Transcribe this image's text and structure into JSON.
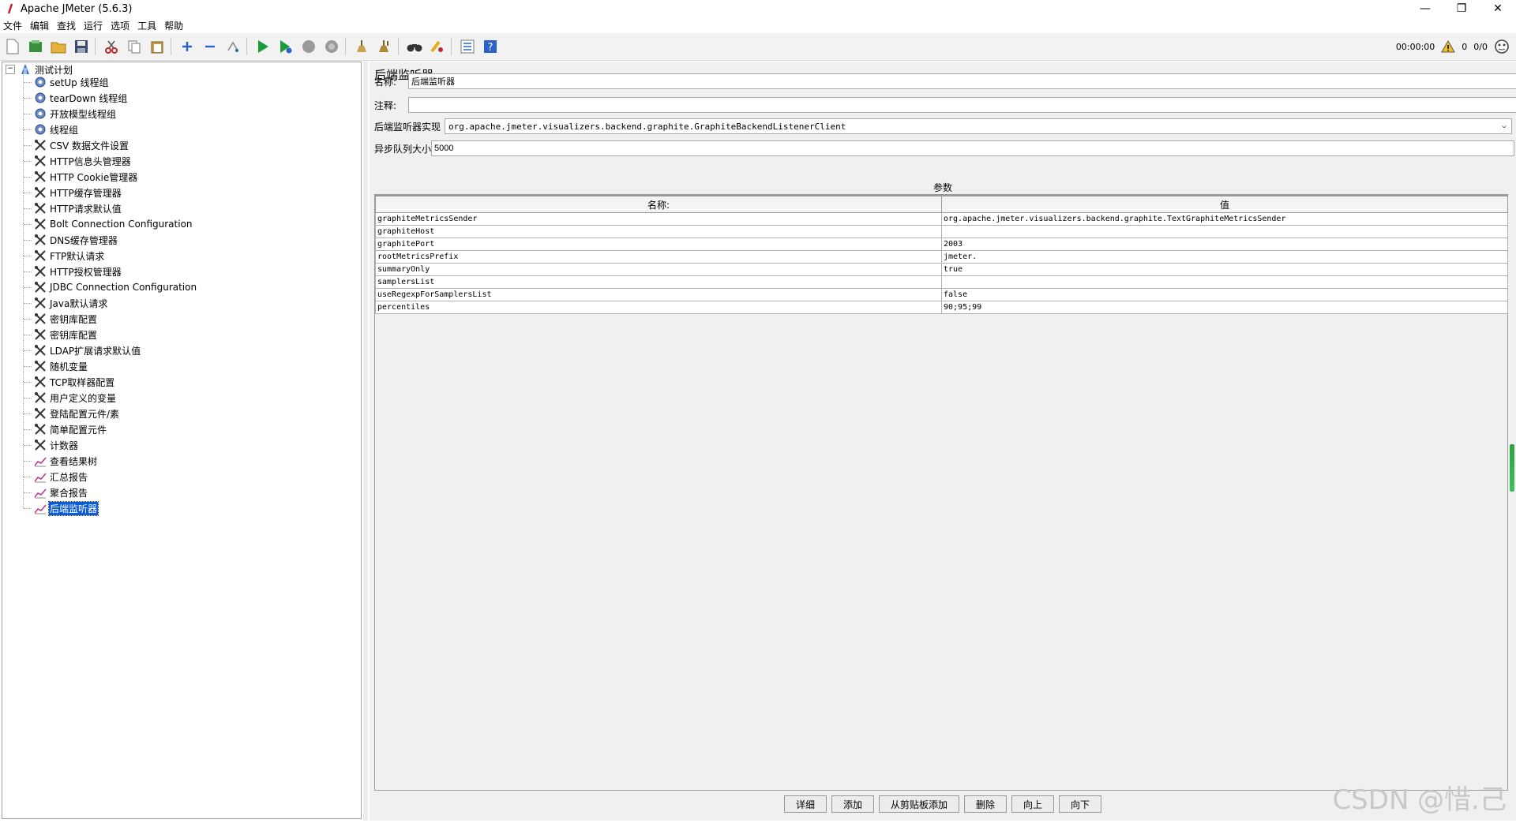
{
  "window": {
    "title": "Apache JMeter (5.6.3)"
  },
  "menu": [
    "文件",
    "编辑",
    "查找",
    "运行",
    "选项",
    "工具",
    "帮助"
  ],
  "status": {
    "timer": "00:00:00",
    "warnings": "0",
    "threads": "0/0"
  },
  "tree": {
    "root": "测试计划",
    "items": [
      {
        "label": "setUp 线程组",
        "icon": "gear-icon"
      },
      {
        "label": "tearDown 线程组",
        "icon": "gear-icon"
      },
      {
        "label": "开放模型线程组",
        "icon": "gear-icon"
      },
      {
        "label": "线程组",
        "icon": "gear-icon"
      },
      {
        "label": "CSV 数据文件设置",
        "icon": "wrench-icon"
      },
      {
        "label": "HTTP信息头管理器",
        "icon": "wrench-icon"
      },
      {
        "label": "HTTP Cookie管理器",
        "icon": "wrench-icon"
      },
      {
        "label": "HTTP缓存管理器",
        "icon": "wrench-icon"
      },
      {
        "label": "HTTP请求默认值",
        "icon": "wrench-icon"
      },
      {
        "label": "Bolt Connection Configuration",
        "icon": "wrench-icon"
      },
      {
        "label": "DNS缓存管理器",
        "icon": "wrench-icon"
      },
      {
        "label": "FTP默认请求",
        "icon": "wrench-icon"
      },
      {
        "label": "HTTP授权管理器",
        "icon": "wrench-icon"
      },
      {
        "label": "JDBC Connection Configuration",
        "icon": "wrench-icon"
      },
      {
        "label": "Java默认请求",
        "icon": "wrench-icon"
      },
      {
        "label": "密钥库配置",
        "icon": "wrench-icon"
      },
      {
        "label": "密钥库配置",
        "icon": "wrench-icon"
      },
      {
        "label": "LDAP扩展请求默认值",
        "icon": "wrench-icon"
      },
      {
        "label": "随机变量",
        "icon": "wrench-icon"
      },
      {
        "label": "TCP取样器配置",
        "icon": "wrench-icon"
      },
      {
        "label": "用户定义的变量",
        "icon": "wrench-icon"
      },
      {
        "label": "登陆配置元件/素",
        "icon": "wrench-icon"
      },
      {
        "label": "简单配置元件",
        "icon": "wrench-icon"
      },
      {
        "label": "计数器",
        "icon": "wrench-icon"
      },
      {
        "label": "查看结果树",
        "icon": "chart-icon"
      },
      {
        "label": "汇总报告",
        "icon": "chart-icon"
      },
      {
        "label": "聚合报告",
        "icon": "chart-icon"
      },
      {
        "label": "后端监听器",
        "icon": "chart-icon",
        "selected": true
      }
    ]
  },
  "panel": {
    "title": "后端监听器",
    "name_label": "名称:",
    "name_value": "后端监听器",
    "comment_label": "注释:",
    "comment_value": "",
    "impl_label": "后端监听器实现",
    "impl_value": "org.apache.jmeter.visualizers.backend.graphite.GraphiteBackendListenerClient",
    "queue_label": "异步队列大小",
    "queue_value": "5000",
    "params_title": "参数",
    "columns": [
      "名称:",
      "值"
    ],
    "rows": [
      [
        "graphiteMetricsSender",
        "org.apache.jmeter.visualizers.backend.graphite.TextGraphiteMetricsSender"
      ],
      [
        "graphiteHost",
        ""
      ],
      [
        "graphitePort",
        "2003"
      ],
      [
        "rootMetricsPrefix",
        "jmeter."
      ],
      [
        "summaryOnly",
        "true"
      ],
      [
        "samplersList",
        ""
      ],
      [
        "useRegexpForSamplersList",
        "false"
      ],
      [
        "percentiles",
        "90;95;99"
      ]
    ],
    "buttons": [
      "详细",
      "添加",
      "从剪贴板添加",
      "删除",
      "向上",
      "向下"
    ]
  },
  "watermark": "CSDN @惜.己"
}
